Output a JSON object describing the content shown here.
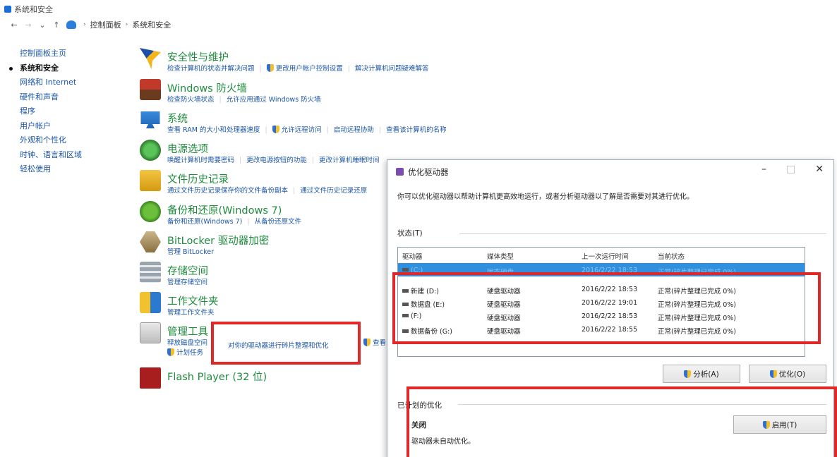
{
  "window": {
    "title": "系统和安全"
  },
  "addressbar": {
    "crumbs": [
      "控制面板",
      "系统和安全"
    ]
  },
  "sidebar": {
    "items": [
      "控制面板主页",
      "系统和安全",
      "网络和 Internet",
      "硬件和声音",
      "程序",
      "用户帐户",
      "外观和个性化",
      "时钟、语言和区域",
      "轻松使用"
    ],
    "current_index": 1
  },
  "categories": [
    {
      "title": "安全性与维护",
      "links": [
        "检查计算机的状态并解决问题",
        "更改用户帐户控制设置",
        "解决计算机问题疑难解答"
      ],
      "shield": [
        false,
        true,
        false
      ]
    },
    {
      "title": "Windows 防火墙",
      "links": [
        "检查防火墙状态",
        "允许应用通过 Windows 防火墙"
      ],
      "shield": [
        false,
        false
      ]
    },
    {
      "title": "系统",
      "links": [
        "查看 RAM 的大小和处理器速度",
        "允许远程访问",
        "启动远程协助",
        "查看该计算机的名称"
      ],
      "shield": [
        false,
        true,
        false,
        false
      ]
    },
    {
      "title": "电源选项",
      "links": [
        "唤醒计算机时需要密码",
        "更改电源按钮的功能",
        "更改计算机睡眠时间"
      ],
      "shield": [
        false,
        false,
        false
      ]
    },
    {
      "title": "文件历史记录",
      "links": [
        "通过文件历史记录保存你的文件备份副本",
        "通过文件历史记录还原"
      ],
      "shield": [
        false,
        false
      ]
    },
    {
      "title": "备份和还原(Windows 7)",
      "links": [
        "备份和还原(Windows 7)",
        "从备份还原文件"
      ],
      "shield": [
        false,
        false
      ]
    },
    {
      "title": "BitLocker 驱动器加密",
      "links": [
        "管理 BitLocker"
      ],
      "shield": [
        false
      ]
    },
    {
      "title": "存储空间",
      "links": [
        "管理存储空间"
      ],
      "shield": [
        false
      ]
    },
    {
      "title": "工作文件夹",
      "links": [
        "管理工作文件夹"
      ],
      "shield": [
        false
      ]
    },
    {
      "title": "管理工具",
      "links": [
        "释放磁盘空间",
        "计划任务"
      ],
      "shield": [
        false,
        true
      ]
    },
    {
      "title": "Flash Player (32 位)",
      "links": [],
      "shield": []
    }
  ],
  "highlight_link": "对你的驱动器进行碎片整理和优化",
  "highlight_partial": "查看",
  "dialog": {
    "title": "优化驱动器",
    "description": "你可以优化驱动器以帮助计算机更高效地运行，或者分析驱动器以了解是否需要对其进行优化。",
    "status_label": "状态(T)",
    "columns": [
      "驱动器",
      "媒体类型",
      "上一次运行时间",
      "当前状态"
    ],
    "drives": [
      {
        "name": "(C:)",
        "media": "固态硬盘",
        "last": "2016/2/22 18:53",
        "status": "正常(碎片整理已完成 0%)",
        "selected": true
      },
      {
        "name": "新建 (D:)",
        "media": "硬盘驱动器",
        "last": "2016/2/22 18:53",
        "status": "正常(碎片整理已完成 0%)",
        "selected": false
      },
      {
        "name": "数据盘 (E:)",
        "media": "硬盘驱动器",
        "last": "2016/2/22 19:01",
        "status": "正常(碎片整理已完成 0%)",
        "selected": false
      },
      {
        "name": "(F:)",
        "media": "硬盘驱动器",
        "last": "2016/2/22 18:53",
        "status": "正常(碎片整理已完成 0%)",
        "selected": false
      },
      {
        "name": "数据备份 (G:)",
        "media": "硬盘驱动器",
        "last": "2016/2/22 18:55",
        "status": "正常(碎片整理已完成 0%)",
        "selected": false
      }
    ],
    "analyze_btn": "分析(A)",
    "optimize_btn": "优化(O)",
    "scheduled_label": "已计划的优化",
    "scheduled_state": "关闭",
    "scheduled_text": "驱动器未自动优化。",
    "enable_btn": "启用(T)",
    "controls": {
      "minimize": "–",
      "maximize": "□",
      "close": "✕"
    }
  },
  "colors": {
    "link": "#1c56a6",
    "category_title": "#1e8c3c",
    "highlight_red": "#e02828",
    "selection": "#2f90e0"
  }
}
